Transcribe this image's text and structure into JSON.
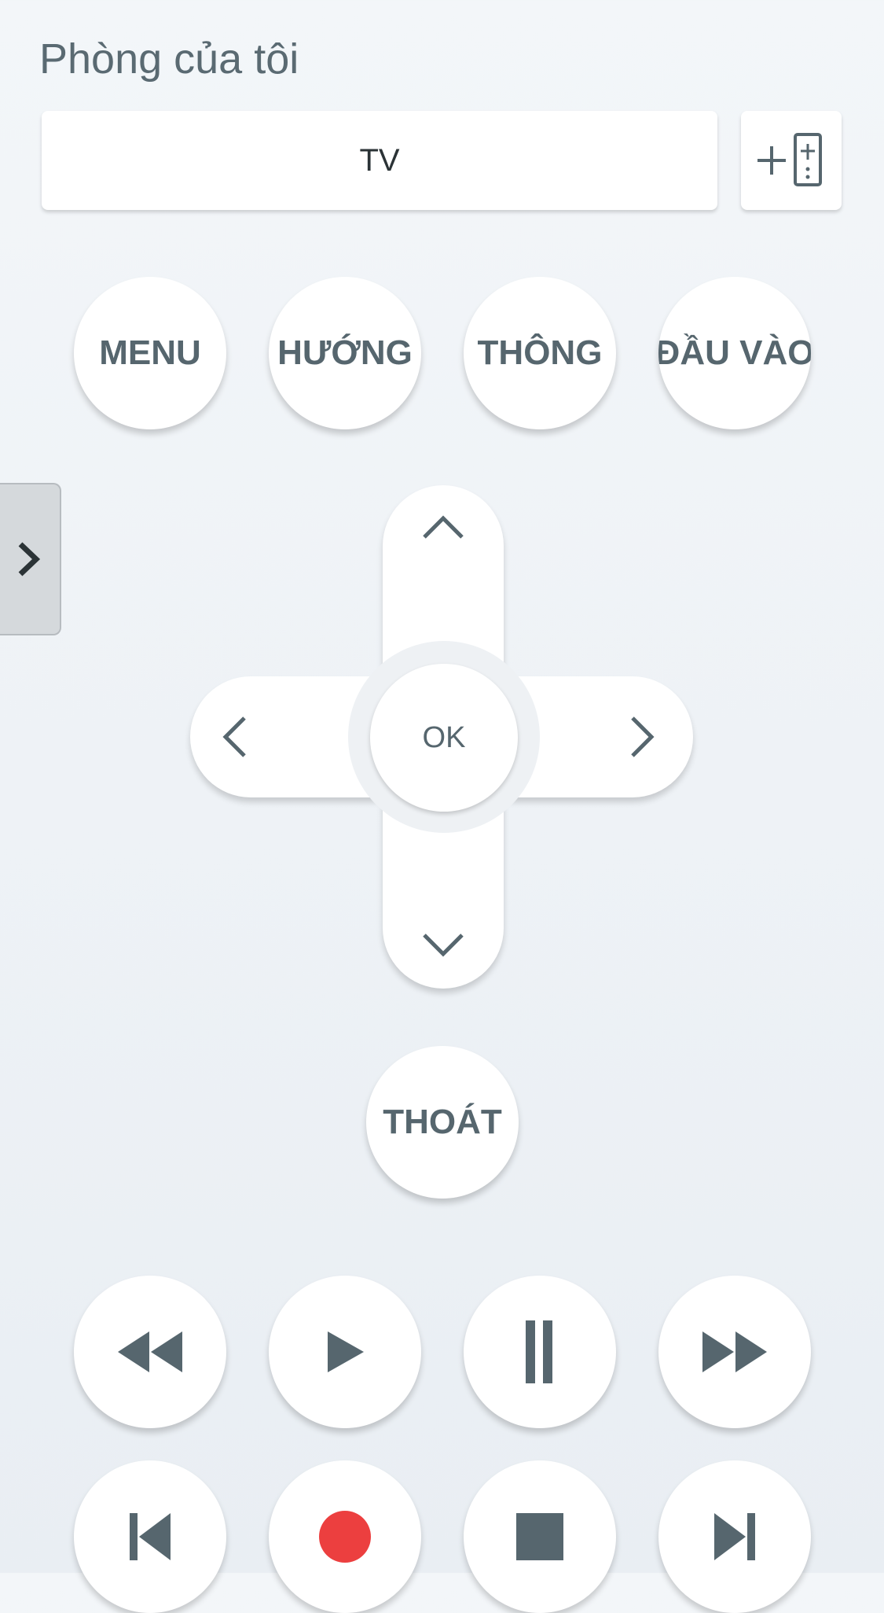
{
  "header": {
    "room_title": "Phòng của tôi"
  },
  "device_tabs": [
    {
      "label": "TV"
    }
  ],
  "quick_buttons": [
    {
      "label": "MENU"
    },
    {
      "label": "HƯỚNG"
    },
    {
      "label": "THÔNG"
    },
    {
      "label": "ĐẦU VÀO"
    }
  ],
  "dpad": {
    "ok_label": "OK"
  },
  "exit_button": {
    "label": "THOÁT"
  },
  "media_controls_row1": [
    "rewind-icon",
    "play-icon",
    "pause-icon",
    "fast-forward-icon"
  ],
  "media_controls_row2": [
    "skip-previous-icon",
    "record-icon",
    "stop-icon",
    "skip-next-icon"
  ],
  "colors": {
    "background": "#eef2f5",
    "button": "#ffffff",
    "icon": "#56666e",
    "record": "#ec3f3f"
  }
}
